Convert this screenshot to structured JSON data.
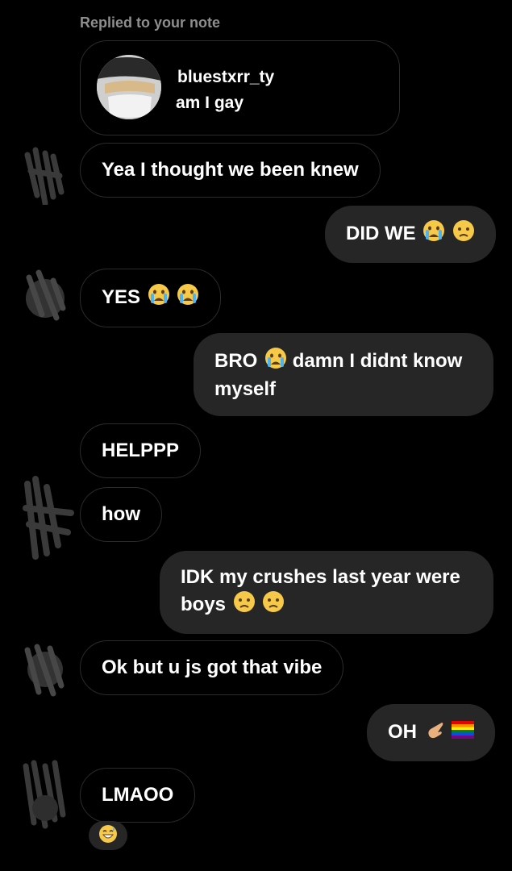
{
  "reply_context": "Replied to your note",
  "note": {
    "username": "bluestxrr_ty",
    "text": "am I gay"
  },
  "messages": [
    {
      "side": "in",
      "text": "Yea I thought we been knew",
      "emoji": []
    },
    {
      "side": "out",
      "text": "DID WE",
      "emoji": [
        "crying-face",
        "worried-face"
      ]
    },
    {
      "side": "in",
      "text": "YES",
      "emoji": [
        "crying-face",
        "crying-face"
      ]
    },
    {
      "side": "out",
      "text": "BRO",
      "text_after": "damn I didnt know myself",
      "emoji": [
        "crying-face"
      ]
    },
    {
      "side": "in",
      "text": "HELPPP",
      "emoji": []
    },
    {
      "side": "in",
      "text": "how",
      "emoji": []
    },
    {
      "side": "out",
      "text": "IDK my crushes last year were boys",
      "emoji": [
        "worried-face",
        "worried-face"
      ]
    },
    {
      "side": "in",
      "text": "Ok but u js got that vibe",
      "emoji": []
    },
    {
      "side": "out",
      "text": "OH",
      "emoji": [
        "pointing-hand",
        "rainbow-flag"
      ]
    },
    {
      "side": "in",
      "text": "LMAOO",
      "emoji": []
    }
  ],
  "reaction": "grinning-sweat-face",
  "colors": {
    "background": "#000000",
    "outgoing_bubble": "#262626",
    "incoming_border": "#2b2b2b",
    "muted_text": "#8e8e8e",
    "text": "#ffffff"
  }
}
